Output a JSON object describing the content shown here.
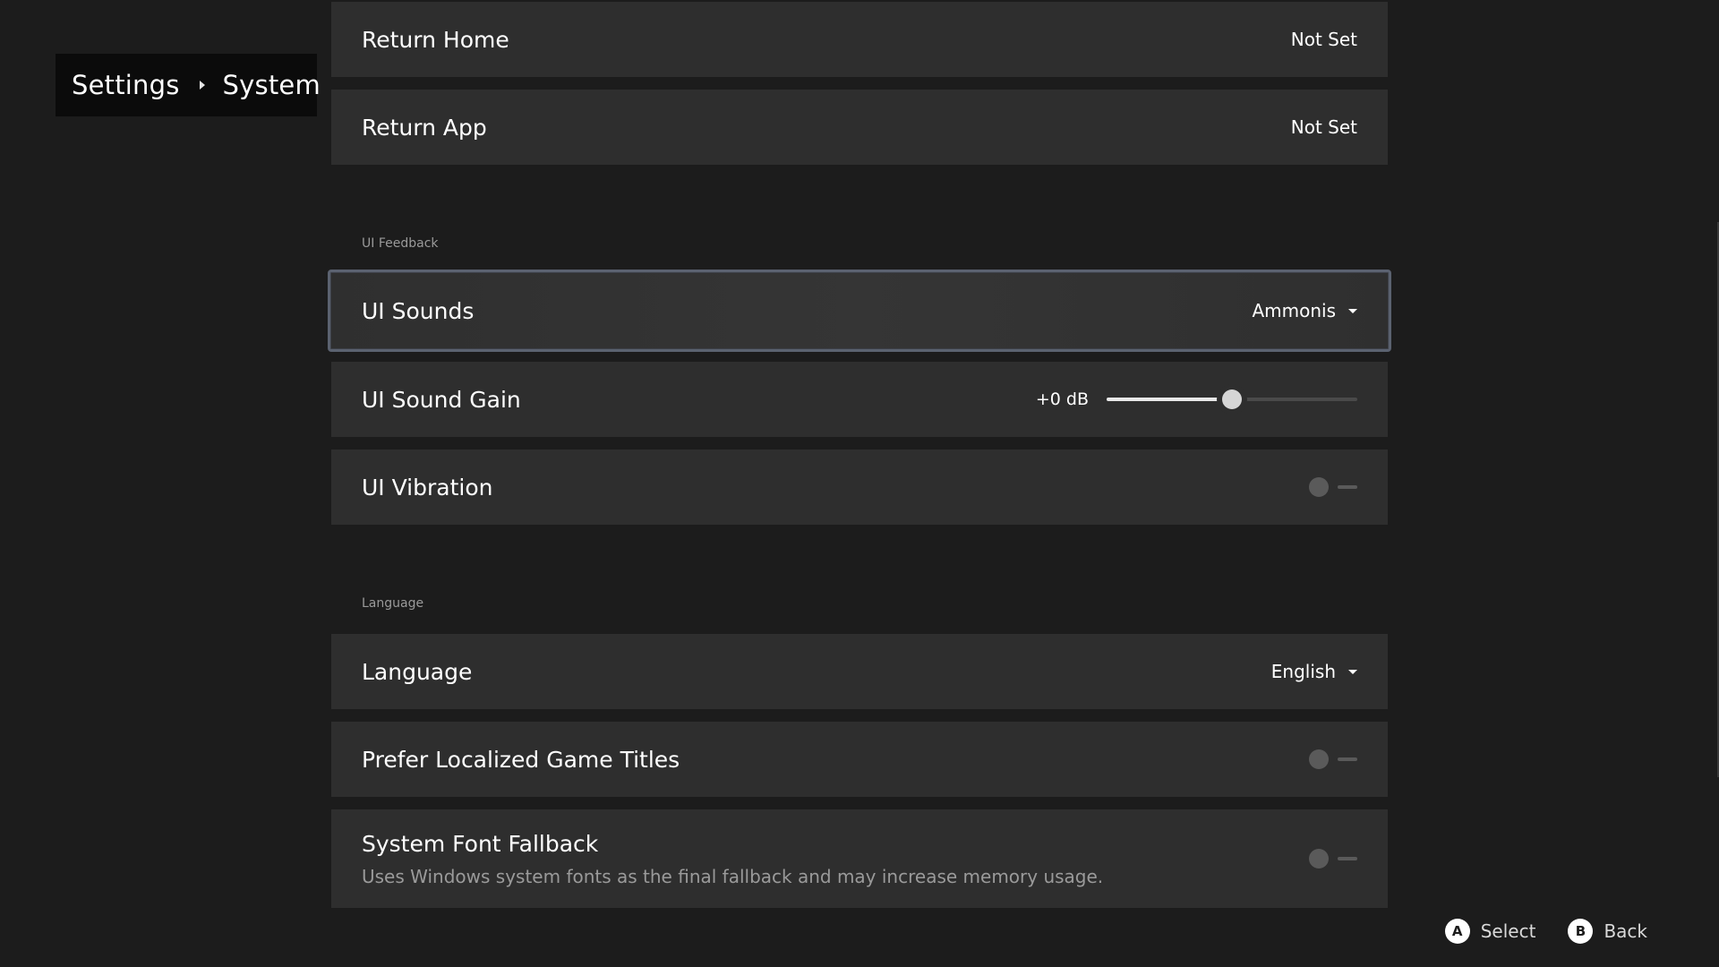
{
  "breadcrumb": {
    "root": "Settings",
    "current": "System"
  },
  "rows": {
    "return_home": {
      "label": "Return Home",
      "value": "Not Set"
    },
    "return_app": {
      "label": "Return App",
      "value": "Not Set"
    },
    "ui_sounds": {
      "label": "UI Sounds",
      "value": "Ammonis"
    },
    "ui_sound_gain": {
      "label": "UI Sound Gain",
      "value": "+0 dB",
      "level_fraction": 0.5
    },
    "ui_vibration": {
      "label": "UI Vibration",
      "enabled": false
    },
    "language": {
      "label": "Language",
      "value": "English"
    },
    "prefer_localized": {
      "label": "Prefer Localized Game Titles",
      "enabled": false
    },
    "system_font_fallback": {
      "label": "System Font Fallback",
      "description": "Uses Windows system fonts as the final fallback and may increase memory usage.",
      "enabled": false
    }
  },
  "sections": {
    "ui_feedback": "UI Feedback",
    "language": "Language"
  },
  "footer": {
    "select_button": "A",
    "select_label": "Select",
    "back_button": "B",
    "back_label": "Back"
  },
  "icons": {
    "breadcrumb_separator": "chevron-right-icon",
    "dropdown": "caret-down-icon"
  }
}
